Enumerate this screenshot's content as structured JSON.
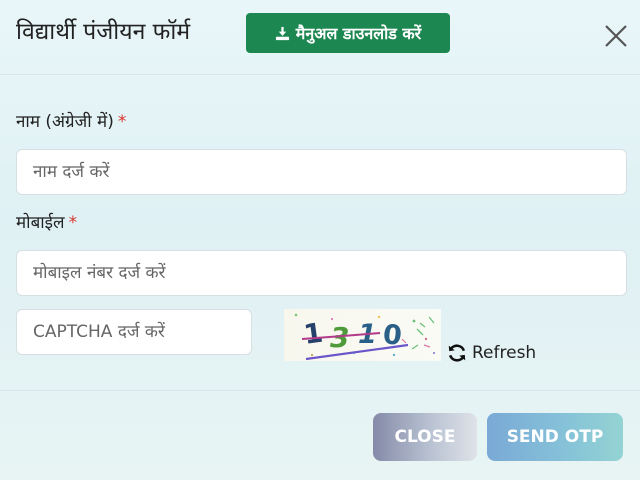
{
  "header": {
    "title": "विद्यार्थी पंजीयन फॉर्म",
    "manual_button_label": "मैनुअल डाउनलोड करें",
    "manual_button_icon": "download-icon",
    "close_icon": "close-icon"
  },
  "form": {
    "name_label": "नाम (अंग्रेजी में)",
    "name_required_mark": "*",
    "name_placeholder": "नाम दर्ज करें",
    "mobile_label": "मोबाईल",
    "mobile_required_mark": "*",
    "mobile_placeholder": "मोबाइल नंबर दर्ज करें",
    "captcha_placeholder": "CAPTCHA दर्ज करें",
    "captcha_text": [
      "1",
      "3",
      "1",
      "0"
    ],
    "refresh_label": "Refresh",
    "refresh_icon": "refresh-icon"
  },
  "footer": {
    "close_label": "CLOSE",
    "send_otp_label": "SEND OTP"
  },
  "colors": {
    "manual_button": "#1d8751",
    "required_mark": "#d9342b",
    "close_button": "#858ba8",
    "send_otp_button": "#7aa9d6"
  }
}
